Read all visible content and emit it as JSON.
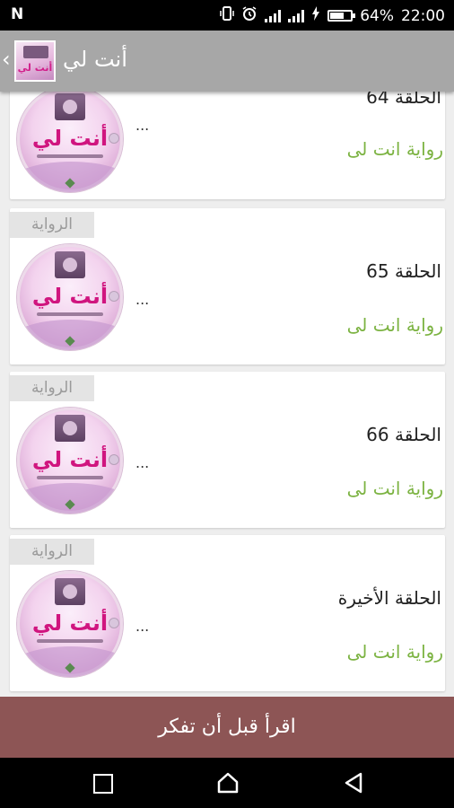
{
  "status_bar": {
    "carrier_icon": "N",
    "icons": [
      "vibrate-icon",
      "alarm-icon",
      "signal-icon",
      "charging-icon",
      "battery-icon"
    ],
    "battery": "64%",
    "time": "22:00"
  },
  "app_bar": {
    "title": "أنت لي",
    "logo_text": "أنت لي",
    "back_icon": "chevron-left-icon"
  },
  "episodes": [
    {
      "title": "الحلقة 64",
      "novel": "رواية انت لى",
      "excerpt": "...",
      "badge": "",
      "cover_text": "أنت لي"
    },
    {
      "title": "الحلقة 65",
      "novel": "رواية انت لى",
      "excerpt": "...",
      "badge": "الرواية",
      "cover_text": "أنت لي"
    },
    {
      "title": "الحلقة 66",
      "novel": "رواية انت لى",
      "excerpt": "...",
      "badge": "الرواية",
      "cover_text": "أنت لي"
    },
    {
      "title": "الحلقة الأخيرة",
      "novel": "رواية انت لى",
      "excerpt": "...",
      "badge": "الرواية",
      "cover_text": "أنت لي"
    }
  ],
  "bottom_button": {
    "label": "اقرأ قبل أن تفكر"
  },
  "nav_bar": {
    "icons": [
      "recents-icon",
      "home-icon",
      "back-icon"
    ]
  },
  "colors": {
    "app_bar": "#a7a7a7",
    "accent_green": "#7cb342",
    "bottom_button": "#8d5555",
    "cover_pink": "#d0157f"
  }
}
